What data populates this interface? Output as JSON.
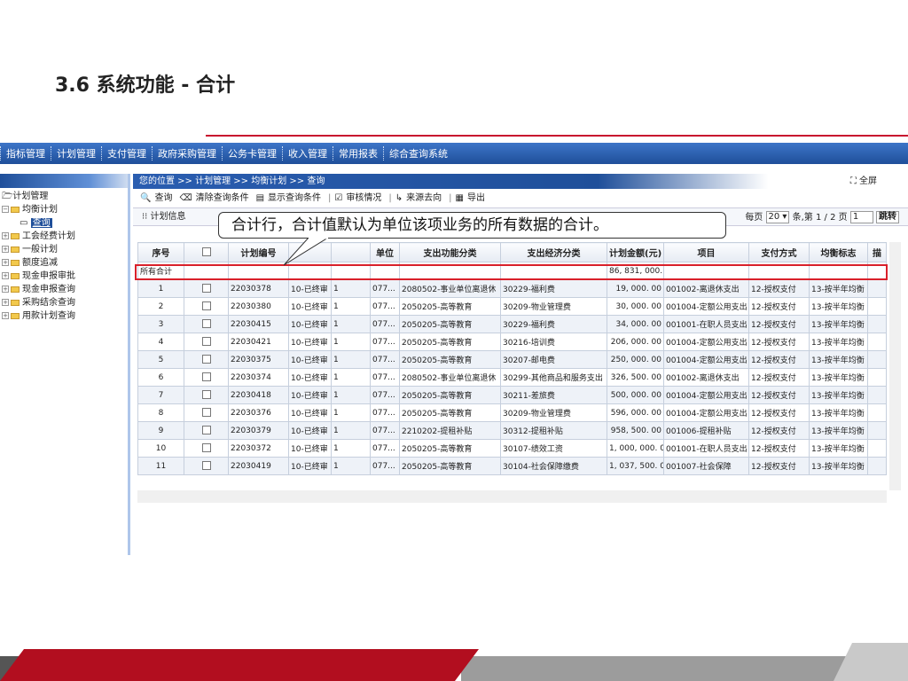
{
  "slide": {
    "title": "3.6 系统功能 - 合计"
  },
  "menu": [
    "指标管理",
    "计划管理",
    "支付管理",
    "政府采购管理",
    "公务卡管理",
    "收入管理",
    "常用报表",
    "综合查询系统"
  ],
  "sidebar": {
    "root": "计划管理",
    "items": [
      {
        "label": "均衡计划",
        "expanded": true
      },
      {
        "label": "查询",
        "child": true
      },
      {
        "label": "工会经费计划"
      },
      {
        "label": "一般计划"
      },
      {
        "label": "额度追减"
      },
      {
        "label": "现金申报审批"
      },
      {
        "label": "现金申报查询"
      },
      {
        "label": "采购结余查询"
      },
      {
        "label": "用款计划查询"
      }
    ]
  },
  "breadcrumb": "您的位置 >> 计划管理 >> 均衡计划 >> 查询",
  "fullscreen": "全屏",
  "toolbar": [
    "查询",
    "清除查询条件",
    "显示查询条件",
    "审核情况",
    "来源去向",
    "导出"
  ],
  "infobar": {
    "title": "计划信息",
    "per_page_label": "每页",
    "per_page": "20",
    "page_text": "条,第 1 / 2 页",
    "page_input": "1",
    "jump": "跳转"
  },
  "callout": "合计行，合计值默认为单位该项业务的所有数据的合计。",
  "table": {
    "headers": [
      "序号",
      "",
      "计划编号",
      "",
      "",
      "单位",
      "支出功能分类",
      "支出经济分类",
      "计划金额(元)",
      "项目",
      "支付方式",
      "均衡标志",
      "描"
    ],
    "total": {
      "label": "所有合计",
      "amount": "86, 831, 000. 0"
    },
    "rows": [
      [
        "1",
        "22030378",
        "10-已终审",
        "1",
        "077...",
        "2080502-事业单位离退休",
        "30229-福利费",
        "19, 000. 00",
        "001002-离退休支出",
        "12-授权支付",
        "13-按半年均衡"
      ],
      [
        "2",
        "22030380",
        "10-已终审",
        "1",
        "077...",
        "2050205-高等教育",
        "30209-物业管理费",
        "30, 000. 00",
        "001004-定额公用支出",
        "12-授权支付",
        "13-按半年均衡"
      ],
      [
        "3",
        "22030415",
        "10-已终审",
        "1",
        "077...",
        "2050205-高等教育",
        "30229-福利费",
        "34, 000. 00",
        "001001-在职人员支出",
        "12-授权支付",
        "13-按半年均衡"
      ],
      [
        "4",
        "22030421",
        "10-已终审",
        "1",
        "077...",
        "2050205-高等教育",
        "30216-培训费",
        "206, 000. 00",
        "001004-定额公用支出",
        "12-授权支付",
        "13-按半年均衡"
      ],
      [
        "5",
        "22030375",
        "10-已终审",
        "1",
        "077...",
        "2050205-高等教育",
        "30207-邮电费",
        "250, 000. 00",
        "001004-定额公用支出",
        "12-授权支付",
        "13-按半年均衡"
      ],
      [
        "6",
        "22030374",
        "10-已终审",
        "1",
        "077...",
        "2080502-事业单位离退休",
        "30299-其他商品和服务支出",
        "326, 500. 00",
        "001002-离退休支出",
        "12-授权支付",
        "13-按半年均衡"
      ],
      [
        "7",
        "22030418",
        "10-已终审",
        "1",
        "077...",
        "2050205-高等教育",
        "30211-差旅费",
        "500, 000. 00",
        "001004-定额公用支出",
        "12-授权支付",
        "13-按半年均衡"
      ],
      [
        "8",
        "22030376",
        "10-已终审",
        "1",
        "077...",
        "2050205-高等教育",
        "30209-物业管理费",
        "596, 000. 00",
        "001004-定额公用支出",
        "12-授权支付",
        "13-按半年均衡"
      ],
      [
        "9",
        "22030379",
        "10-已终审",
        "1",
        "077...",
        "2210202-提租补贴",
        "30312-提租补贴",
        "958, 500. 00",
        "001006-提租补贴",
        "12-授权支付",
        "13-按半年均衡"
      ],
      [
        "10",
        "22030372",
        "10-已终审",
        "1",
        "077...",
        "2050205-高等教育",
        "30107-绩效工资",
        "1, 000, 000. 00",
        "001001-在职人员支出",
        "12-授权支付",
        "13-按半年均衡"
      ],
      [
        "11",
        "22030419",
        "10-已终审",
        "1",
        "077...",
        "2050205-高等教育",
        "30104-社会保障缴费",
        "1, 037, 500. 00",
        "001007-社会保障",
        "12-授权支付",
        "13-按半年均衡"
      ]
    ]
  },
  "colors": {
    "accent_red": "#d9202a",
    "menu_blue": "#1f4f9a"
  }
}
